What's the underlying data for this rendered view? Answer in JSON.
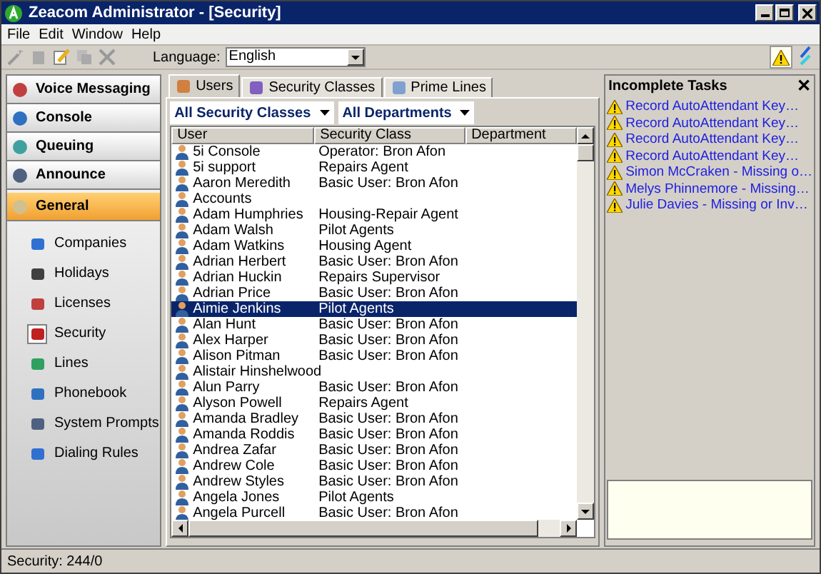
{
  "window": {
    "title": "Zeacom Administrator - [Security]"
  },
  "menu": [
    "File",
    "Edit",
    "Window",
    "Help"
  ],
  "toolbar": {
    "language_label": "Language:",
    "language_value": "English"
  },
  "nav_sections": [
    {
      "label": "Voice Messaging",
      "selected": false
    },
    {
      "label": "Console",
      "selected": false
    },
    {
      "label": "Queuing",
      "selected": false
    },
    {
      "label": "Announce",
      "selected": false
    },
    {
      "label": "General",
      "selected": true
    }
  ],
  "nav_items": [
    {
      "label": "Companies",
      "selected": false
    },
    {
      "label": "Holidays",
      "selected": false
    },
    {
      "label": "Licenses",
      "selected": false
    },
    {
      "label": "Security",
      "selected": true
    },
    {
      "label": "Lines",
      "selected": false
    },
    {
      "label": "Phonebook",
      "selected": false
    },
    {
      "label": "System Prompts",
      "selected": false
    },
    {
      "label": "Dialing Rules",
      "selected": false
    }
  ],
  "tabs": [
    {
      "label": "Users",
      "selected": true
    },
    {
      "label": "Security Classes",
      "selected": false
    },
    {
      "label": "Prime Lines",
      "selected": false
    }
  ],
  "filters": [
    "All Security Classes",
    "All Departments"
  ],
  "table": {
    "columns": [
      "User",
      "Security Class",
      "Department"
    ],
    "rows": [
      {
        "user": "5i Console",
        "security_class": "Operator: Bron Afon",
        "selected": false
      },
      {
        "user": "5i support",
        "security_class": "Repairs Agent",
        "selected": false
      },
      {
        "user": "Aaron Meredith",
        "security_class": "Basic User: Bron Afon",
        "selected": false
      },
      {
        "user": "Accounts",
        "selected": false
      },
      {
        "user": "Adam Humphries",
        "security_class": "Housing-Repair Agent",
        "selected": false
      },
      {
        "user": "Adam Walsh",
        "security_class": "Pilot Agents",
        "selected": false
      },
      {
        "user": "Adam Watkins",
        "security_class": "Housing Agent",
        "selected": false
      },
      {
        "user": "Adrian Herbert",
        "security_class": "Basic User: Bron Afon",
        "selected": false
      },
      {
        "user": "Adrian Huckin",
        "security_class": "Repairs Supervisor",
        "selected": false
      },
      {
        "user": "Adrian Price",
        "security_class": "Basic User: Bron Afon",
        "selected": false
      },
      {
        "user": "Aimie Jenkins",
        "security_class": "Pilot Agents",
        "selected": true
      },
      {
        "user": "Alan Hunt",
        "security_class": "Basic User: Bron Afon",
        "selected": false
      },
      {
        "user": "Alex Harper",
        "security_class": "Basic User: Bron Afon",
        "selected": false
      },
      {
        "user": "Alison Pitman",
        "security_class": "Basic User: Bron Afon",
        "selected": false
      },
      {
        "user": "Alistair Hinshelwood",
        "selected": false
      },
      {
        "user": "Alun Parry",
        "security_class": "Basic User: Bron Afon",
        "selected": false
      },
      {
        "user": "Alyson Powell",
        "security_class": "Repairs Agent",
        "selected": false
      },
      {
        "user": "Amanda Bradley",
        "security_class": "Basic User: Bron Afon",
        "selected": false
      },
      {
        "user": "Amanda Roddis",
        "security_class": "Basic User: Bron Afon",
        "selected": false
      },
      {
        "user": "Andrea Zafar",
        "security_class": "Basic User: Bron Afon",
        "selected": false
      },
      {
        "user": "Andrew Cole",
        "security_class": "Basic User: Bron Afon",
        "selected": false
      },
      {
        "user": "Andrew Styles",
        "security_class": "Basic User: Bron Afon",
        "selected": false
      },
      {
        "user": "Angela Jones",
        "security_class": "Pilot Agents",
        "selected": false
      },
      {
        "user": "Angela Purcell",
        "security_class": "Basic User: Bron Afon",
        "selected": false
      }
    ]
  },
  "tasks_panel": {
    "title": "Incomplete Tasks",
    "close": "✕",
    "tasks": [
      "Record AutoAttendant Key…",
      "Record AutoAttendant Key…",
      "Record AutoAttendant Key…",
      "Record AutoAttendant Key…",
      "Simon McCraken - Missing o…",
      "Melys Phinnemore - Missing…",
      "Julie Davies - Missing or Inv…"
    ]
  },
  "status_bar": "Security: 244/0"
}
